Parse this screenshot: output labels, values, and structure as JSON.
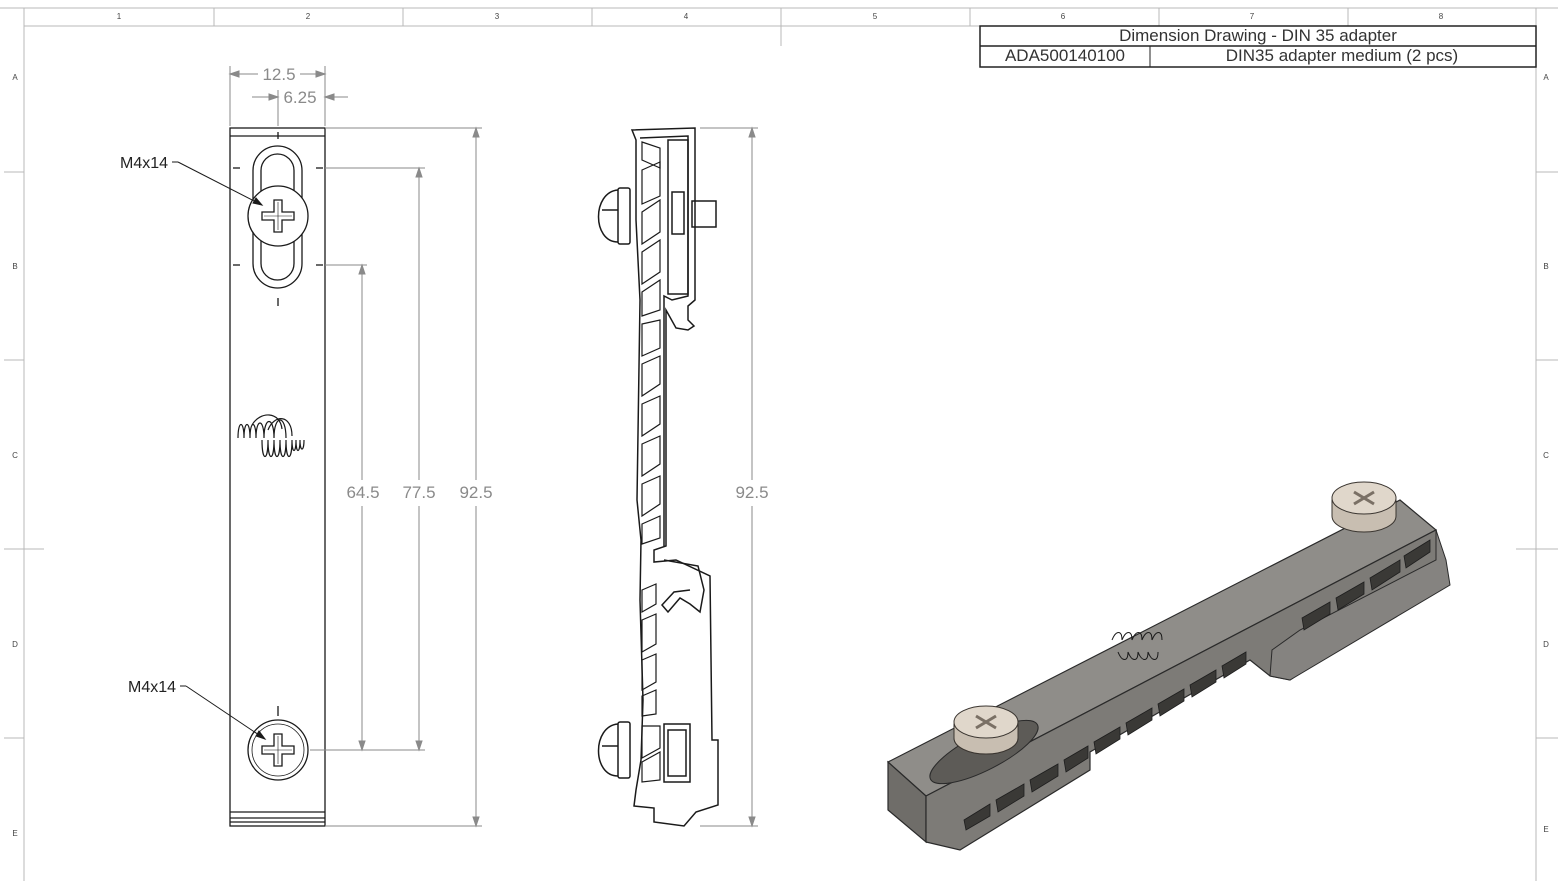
{
  "title_block": {
    "title": "Dimension Drawing - DIN 35 adapter",
    "part_number": "ADA500140100",
    "description": "DIN35 adapter medium (2 pcs)"
  },
  "grid": {
    "columns": [
      "1",
      "2",
      "3",
      "4",
      "5",
      "6",
      "7",
      "8"
    ],
    "rows": [
      "A",
      "B",
      "C",
      "D",
      "E"
    ]
  },
  "front_view": {
    "width_dim": "12.5",
    "half_width_dim": "6.25",
    "screw_top_callout": "M4x14",
    "screw_bottom_callout": "M4x14",
    "dim_slot_to_screw": "64.5",
    "dim_slot_span": "77.5",
    "dim_overall": "92.5"
  },
  "side_view": {
    "dim_overall": "92.5"
  },
  "colors": {
    "line": "#1a1a1a",
    "dimension": "#8a8a8a",
    "part_body": "#8c8a86",
    "screw_head": "#d8cfc2"
  }
}
